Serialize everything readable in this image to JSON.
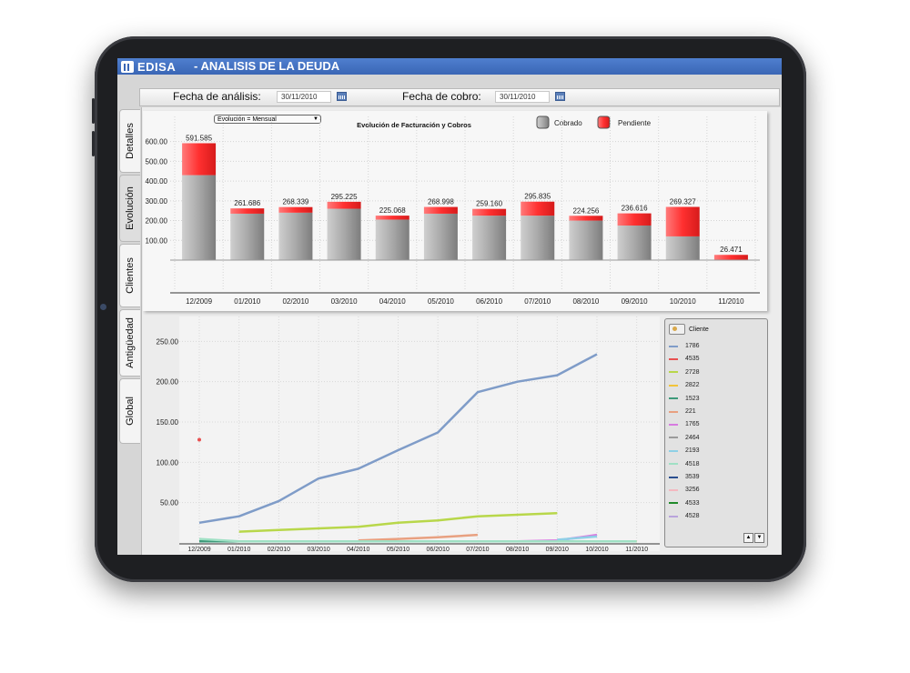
{
  "app": {
    "logo_text": "EDISA",
    "title": "- ANALISIS DE LA DEUDA"
  },
  "toolbar": {
    "analysis_label": "Fecha de análisis:",
    "analysis_date": "30/11/2010",
    "collection_label": "Fecha de cobro:",
    "collection_date": "30/11/2010"
  },
  "tabs": [
    {
      "label": "Detalles",
      "active": false
    },
    {
      "label": "Evolución",
      "active": true
    },
    {
      "label": "Clientes",
      "active": false
    },
    {
      "label": "Antigüedad",
      "active": false
    },
    {
      "label": "Global",
      "active": false
    }
  ],
  "selector": {
    "value": "Evolución    =  Mensual"
  },
  "chart_data": [
    {
      "type": "bar",
      "title": "Evolución de Facturación y Cobros",
      "categories": [
        "12/2009",
        "01/2010",
        "02/2010",
        "03/2010",
        "04/2010",
        "05/2010",
        "06/2010",
        "07/2010",
        "08/2010",
        "09/2010",
        "10/2010",
        "11/2010"
      ],
      "series": [
        {
          "name": "Cobrado",
          "color": "#a8a8a8",
          "values": [
            430,
            235,
            240,
            260,
            205,
            235,
            225,
            225,
            200,
            175,
            120,
            0
          ]
        },
        {
          "name": "Pendiente",
          "color": "#ff3b3b",
          "values": [
            161.585,
            26.686,
            28.339,
            35.225,
            20.068,
            33.998,
            34.16,
            70.835,
            24.256,
            61.616,
            149.327,
            26.471
          ]
        }
      ],
      "data_labels": [
        "591.585",
        "261.686",
        "268.339",
        "295.225",
        "225.068",
        "268.998",
        "259.160",
        "295.835",
        "224.256",
        "236.616",
        "269.327",
        "26.471"
      ],
      "ytick_labels": [
        "100.00",
        "200.00",
        "300.00",
        "400.00",
        "500.00",
        "600.00"
      ],
      "ylim": [
        0,
        650
      ],
      "legend_position": "top-right",
      "stacked": true
    },
    {
      "type": "line",
      "categories": [
        "12/2009",
        "01/2010",
        "02/2010",
        "03/2010",
        "04/2010",
        "05/2010",
        "06/2010",
        "07/2010",
        "08/2010",
        "09/2010",
        "10/2010",
        "11/2010"
      ],
      "ytick_labels": [
        "50.00",
        "100.00",
        "150.00",
        "200.00",
        "250.00"
      ],
      "ylim": [
        0,
        260
      ],
      "legend_title": "Cliente",
      "series": [
        {
          "name": "1786",
          "color": "#7f9cc8",
          "values": [
            25,
            33,
            52,
            80,
            92,
            115,
            137,
            187,
            200,
            208,
            234,
            null
          ]
        },
        {
          "name": "4535",
          "color": "#e85050",
          "values": [
            128,
            null,
            null,
            null,
            null,
            null,
            null,
            null,
            null,
            null,
            null,
            null
          ]
        },
        {
          "name": "2728",
          "color": "#b8d74a",
          "values": [
            null,
            14,
            16,
            18,
            20,
            25,
            28,
            33,
            35,
            37,
            null,
            null
          ]
        },
        {
          "name": "2822",
          "color": "#f2c43a",
          "values": [
            null,
            null,
            null,
            null,
            2,
            2,
            2,
            2,
            2,
            2,
            2,
            2
          ]
        },
        {
          "name": "1523",
          "color": "#3e9a7a",
          "values": [
            2,
            2,
            2,
            2,
            2,
            2,
            2,
            2,
            2,
            2,
            null,
            null
          ]
        },
        {
          "name": "221",
          "color": "#e8a080",
          "values": [
            null,
            null,
            null,
            null,
            3,
            5,
            7,
            10,
            null,
            null,
            null,
            null
          ]
        },
        {
          "name": "1765",
          "color": "#d77be0",
          "values": [
            null,
            null,
            null,
            2,
            2,
            2,
            2,
            2,
            2,
            3,
            10,
            null
          ]
        },
        {
          "name": "2464",
          "color": "#9a9a9a",
          "values": [
            null,
            null,
            null,
            null,
            null,
            null,
            null,
            null,
            null,
            null,
            null,
            null
          ]
        },
        {
          "name": "2193",
          "color": "#8ed0e6",
          "values": [
            null,
            null,
            null,
            null,
            null,
            null,
            null,
            null,
            null,
            4,
            8,
            null
          ]
        },
        {
          "name": "4518",
          "color": "#9fe0c4",
          "values": [
            5,
            2,
            2,
            2,
            2,
            2,
            2,
            2,
            2,
            2,
            2,
            2
          ]
        },
        {
          "name": "3539",
          "color": "#2a4f8f",
          "values": [
            null,
            null,
            null,
            null,
            null,
            null,
            null,
            null,
            null,
            null,
            null,
            null
          ]
        },
        {
          "name": "3256",
          "color": "#f4b8c0",
          "values": [
            null,
            null,
            null,
            null,
            null,
            null,
            null,
            null,
            null,
            null,
            null,
            null
          ]
        },
        {
          "name": "4533",
          "color": "#1f8a2a",
          "values": [
            null,
            null,
            null,
            null,
            null,
            null,
            null,
            null,
            null,
            null,
            null,
            null
          ]
        },
        {
          "name": "4528",
          "color": "#b9a4dc",
          "values": [
            null,
            null,
            null,
            null,
            null,
            null,
            null,
            null,
            null,
            null,
            null,
            null
          ]
        }
      ]
    }
  ]
}
